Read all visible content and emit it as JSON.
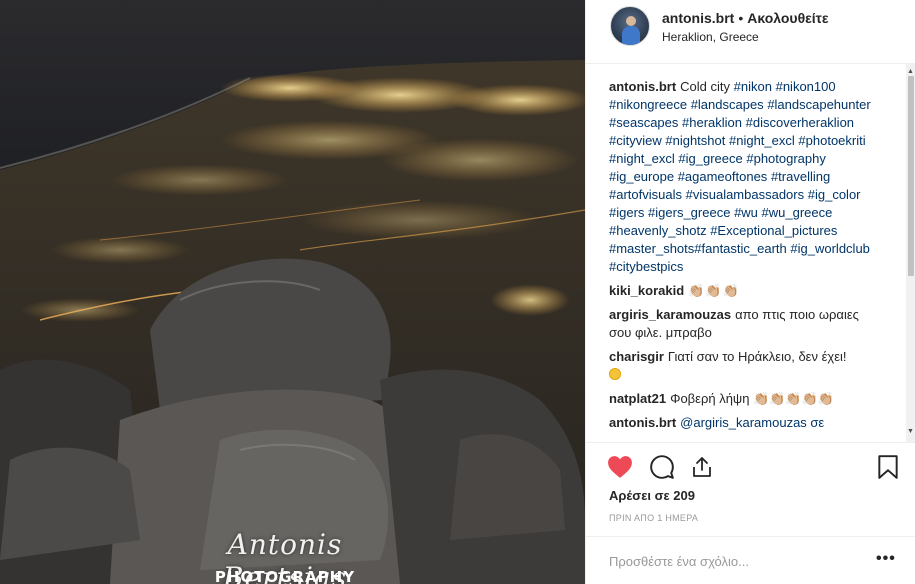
{
  "photo": {
    "signature": "Antonis Bertsias",
    "signature_sub": "PHOTOGRAPHY"
  },
  "header": {
    "username": "antonis.brt",
    "separator": "•",
    "follow_label": "Ακολουθείτε",
    "location": "Heraklion, Greece"
  },
  "caption": {
    "username": "antonis.brt",
    "text": "Cold city",
    "hashtags": [
      "#nikon",
      "#nikon100",
      "#nikongreece",
      "#landscapes",
      "#landscapehunter",
      "#seascapes",
      "#heraklion",
      "#discoverheraklion",
      "#cityview",
      "#nightshot",
      "#night_excl",
      "#photoekriti",
      "#night_excl",
      "#ig_greece",
      "#photography",
      "#ig_europe",
      "#agameoftones",
      "#travelling",
      "#artofvisuals",
      "#visualambassadors",
      "#ig_color",
      "#igers",
      "#igers_greece",
      "#wu",
      "#wu_greece",
      "#heavenly_shotz",
      "#Exceptional_pictures",
      "#master_shots#fantastic_earth",
      "#ig_worldclub",
      "#citybestpics"
    ]
  },
  "comments": [
    {
      "username": "kiki_korakid",
      "text": "👏🏼👏🏼👏🏼"
    },
    {
      "username": "argiris_karamouzas",
      "text": "απο πτις ποιο ωραιες σου φιλε. μπραβο"
    },
    {
      "username": "charisgir",
      "text": "Γιατί σαν το Ηράκλειο, δεν έχει!"
    },
    {
      "username": "natplat21",
      "text": "Φοβερή λήψη 👏🏼👏🏼👏🏼👏🏼👏🏼"
    },
    {
      "username": "antonis.brt",
      "text": "@argiris_karamouzas σε"
    }
  ],
  "actions": {
    "likes": "Αρέσει σε 209",
    "time": "ΠΡΙΝ ΑΠΟ 1 ΗΜΕΡΑ",
    "comment_placeholder": "Προσθέστε ένα σχόλιο...",
    "more": "•••"
  },
  "icons": {
    "like": "heart-icon",
    "comment": "comment-bubble-icon",
    "share": "share-icon",
    "save": "bookmark-icon"
  },
  "colors": {
    "like_active": "#ed4956",
    "hashtag": "#003569",
    "muted": "#999999"
  }
}
